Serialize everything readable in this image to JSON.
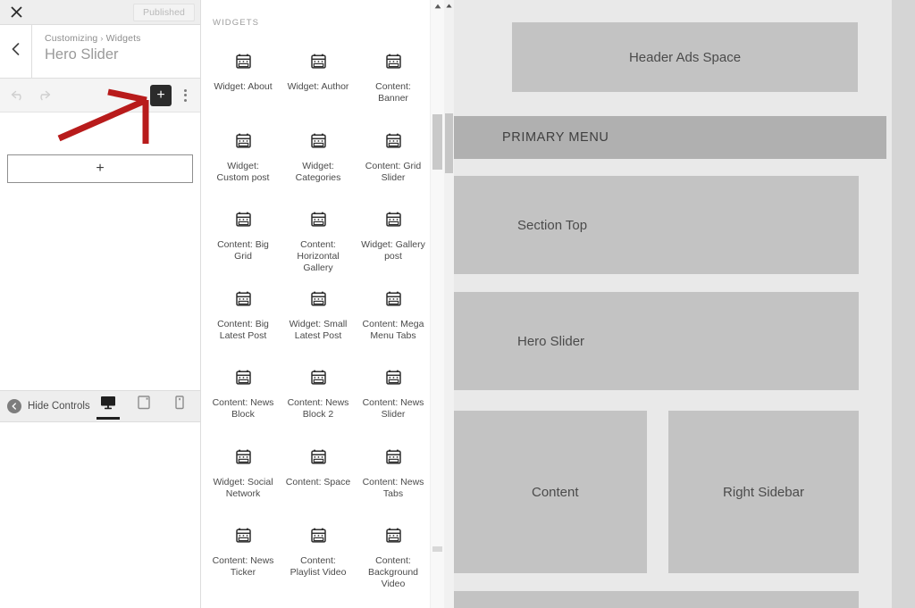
{
  "customizer": {
    "topbar": {
      "close_icon": "close-icon",
      "publish_label": "Published"
    },
    "header": {
      "back_icon": "chevron-left-icon",
      "breadcrumb_root": "Customizing",
      "breadcrumb_separator": "›",
      "breadcrumb_current": "Widgets",
      "section_title": "Hero Slider"
    },
    "toolbar": {
      "undo_icon": "undo-icon",
      "redo_icon": "redo-icon",
      "add_block_label": "+",
      "more_options_icon": "kebab-menu-icon"
    },
    "body": {
      "add_widget_label": "+"
    },
    "footer": {
      "hide_controls_label": "Hide Controls",
      "hide_controls_icon": "collapse-left-icon",
      "devices": [
        {
          "name": "desktop",
          "icon": "desktop-icon",
          "active": true
        },
        {
          "name": "tablet",
          "icon": "tablet-icon",
          "active": false
        },
        {
          "name": "mobile",
          "icon": "mobile-icon",
          "active": false
        }
      ]
    }
  },
  "widget_picker": {
    "title": "WIDGETS",
    "icon_name": "calendar-icon",
    "items": [
      {
        "label": "Widget: About"
      },
      {
        "label": "Widget: Author"
      },
      {
        "label": "Content: Banner"
      },
      {
        "label": "Widget: Custom post"
      },
      {
        "label": "Widget: Categories"
      },
      {
        "label": "Content: Grid Slider"
      },
      {
        "label": "Content: Big Grid"
      },
      {
        "label": "Content: Horizontal Gallery"
      },
      {
        "label": "Widget: Gallery post"
      },
      {
        "label": "Content: Big Latest Post"
      },
      {
        "label": "Widget: Small Latest Post"
      },
      {
        "label": "Content: Mega Menu Tabs"
      },
      {
        "label": "Content: News Block"
      },
      {
        "label": "Content: News Block 2"
      },
      {
        "label": "Content: News Slider"
      },
      {
        "label": "Widget: Social Network"
      },
      {
        "label": "Content: Space"
      },
      {
        "label": "Content: News Tabs"
      },
      {
        "label": "Content: News Ticker"
      },
      {
        "label": "Content: Playlist Video"
      },
      {
        "label": "Content: Background Video"
      }
    ],
    "scrollbar": {
      "up_arrow_icon": "scroll-up-arrow-icon"
    }
  },
  "preview": {
    "scrollbar": {
      "up_arrow_icon": "scroll-up-arrow-icon"
    },
    "blocks": {
      "header_ads": "Header Ads Space",
      "primary_menu": "PRIMARY MENU",
      "section_top": "Section Top",
      "hero_slider": "Hero Slider",
      "content": "Content",
      "right_sidebar": "Right Sidebar"
    }
  },
  "annotation": {
    "type": "arrow",
    "color": "#b81b1b",
    "points_to": "add-block-button"
  }
}
